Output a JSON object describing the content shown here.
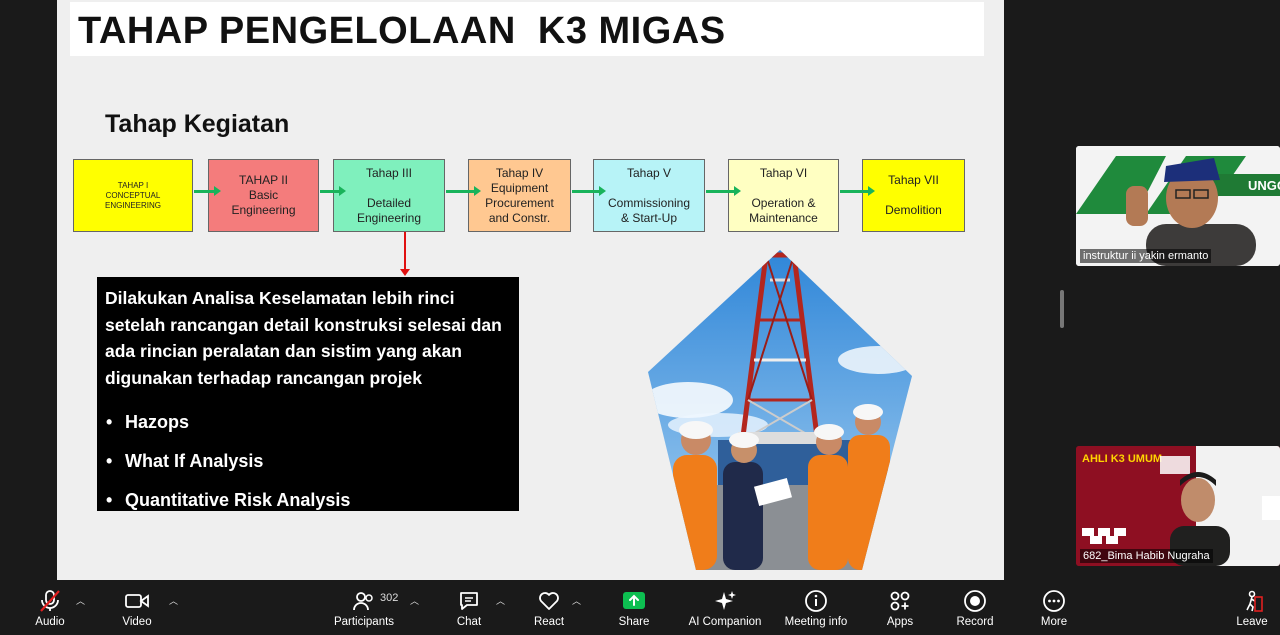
{
  "slide": {
    "title": "TAHAP PENGELOLAAN  K3 MIGAS",
    "subtitle": "Tahap Kegiatan",
    "stages": [
      {
        "lines": [
          "TAHAP I",
          "CONCEPTUAL",
          "ENGINEERING"
        ]
      },
      {
        "lines": [
          "TAHAP II",
          "Basic",
          "Engineering"
        ]
      },
      {
        "lines": [
          "Tahap III",
          "",
          "Detailed",
          "Engineering"
        ]
      },
      {
        "lines": [
          "Tahap IV",
          "Equipment",
          "Procurement",
          "and Constr."
        ]
      },
      {
        "lines": [
          "Tahap V",
          "",
          "Commissioning",
          "& Start-Up"
        ]
      },
      {
        "lines": [
          "Tahap VI",
          "",
          "Operation &",
          "Maintenance"
        ]
      },
      {
        "lines": [
          "Tahap VII",
          "",
          "Demolition"
        ]
      }
    ],
    "stage_colors": [
      "#ffff00",
      "#f47c7c",
      "#7ff0bd",
      "#ffc891",
      "#b7f3f7",
      "#ffffc2",
      "#ffff00"
    ],
    "analysis_text": "Dilakukan Analisa Keselamatan lebih rinci setelah rancangan detail konstruksi selesai dan ada rincian peralatan dan sistim yang akan digunakan terhadap rancangan projek",
    "analysis_bullets": [
      "Hazops",
      "What If Analysis",
      "Quantitative Risk Analysis"
    ]
  },
  "participants_panel": {
    "tile1_name": "instruktur ii yakin ermanto",
    "tile1_logo_text": "UNGGUL",
    "tile2_name": "682_Bima Habib Nugraha",
    "tile2_banner": "AHLI K3 UMUM"
  },
  "toolbar": {
    "audio": "Audio",
    "video": "Video",
    "participants": "Participants",
    "participants_count": "302",
    "chat": "Chat",
    "react": "React",
    "share": "Share",
    "ai_companion": "AI Companion",
    "meeting_info": "Meeting info",
    "apps": "Apps",
    "record": "Record",
    "more": "More",
    "leave": "Leave"
  },
  "colors": {
    "share_green": "#0dbf51",
    "arrow_green": "#19b35b",
    "down_arrow_red": "#e01010"
  }
}
